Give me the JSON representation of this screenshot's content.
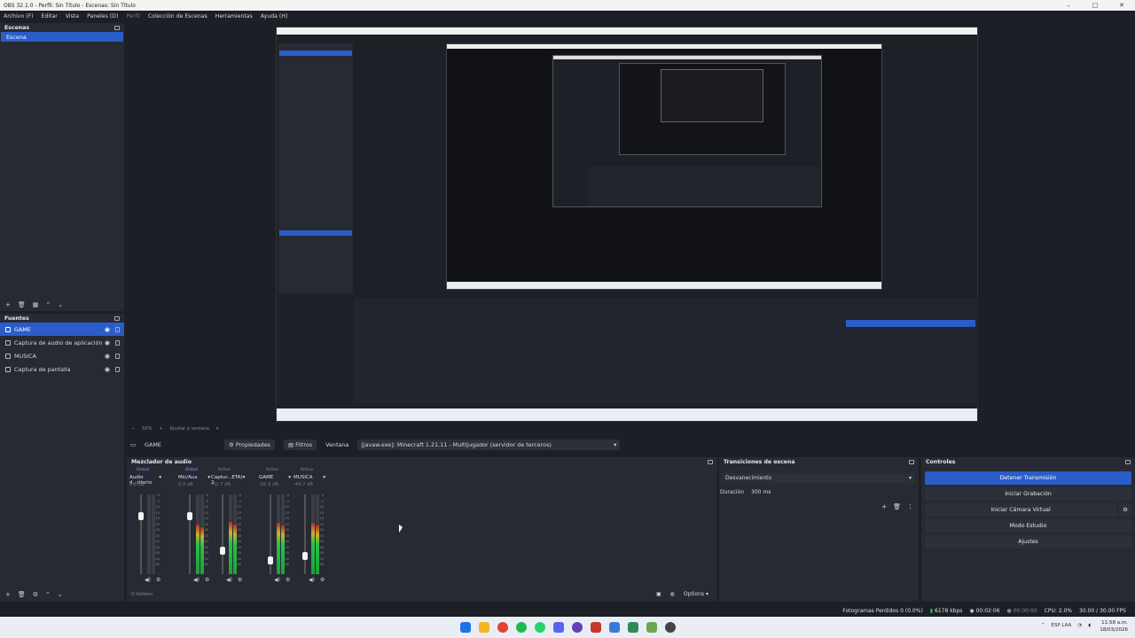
{
  "window": {
    "title": "OBS 32.1.0 - Perfil: Sin Título - Escenas: Sin Título",
    "minimize": "–",
    "maximize": "□",
    "close": "✕"
  },
  "menu": {
    "items": [
      "Archivo (F)",
      "Editar",
      "Vista",
      "Paneles (D)",
      "Perfil",
      "Colección de Escenas",
      "Herramientas",
      "Ayuda (H)"
    ]
  },
  "scenes": {
    "title": "Escenas",
    "items": [
      "Escena"
    ]
  },
  "sources": {
    "title": "Fuentes",
    "items": [
      "GAME",
      "Captura de audio de aplicación",
      "MUSICA",
      "Captura de pantalla"
    ]
  },
  "zoom": {
    "value": "50%",
    "fit_label": "Ajustar a ventana"
  },
  "context_bar": {
    "source": "GAME",
    "properties": "Propiedades",
    "filters": "Filtros",
    "window_label": "Ventana",
    "window_value": "[javaw.exe]: Minecraft 1.21.11 - Multijugador (servidor de terceros)"
  },
  "mixer": {
    "title": "Mezclador de audio",
    "hidden_label": "0 hidden",
    "channels": [
      {
        "tag": "Global",
        "name": "Audio d...ritorio",
        "db": "0.0 dB",
        "level": 0.0,
        "fader": 0.78
      },
      {
        "tag": "Global",
        "name": "Mic/Aux",
        "db": "0.0 dB",
        "level": 0.62,
        "fader": 0.78
      },
      {
        "tag": "Activo",
        "name": "Captur...ETA) 2",
        "db": "-32.7 dB",
        "level": 0.66,
        "fader": 0.35
      },
      {
        "tag": "Activo",
        "name": "GAME",
        "db": "-56.9 dB",
        "level": 0.64,
        "fader": 0.22
      },
      {
        "tag": "Activo",
        "name": "MUSICA",
        "db": "-44.7 dB",
        "level": 0.64,
        "fader": 0.28
      }
    ],
    "scale": [
      "0",
      "-5",
      "-10",
      "-15",
      "-20",
      "-25",
      "-30",
      "-35",
      "-40",
      "-45",
      "-50",
      "-55",
      "-60"
    ],
    "options_label": "Options"
  },
  "transitions": {
    "title": "Transiciones de escena",
    "transition": "Desvanecimiento",
    "duration_label": "Duración",
    "duration_value": "300 ms"
  },
  "controls": {
    "title": "Controles",
    "buttons": [
      "Detener Transmisión",
      "Iniciar Grabación",
      "Iniciar Cámara Virtual",
      "Modo Estudio",
      "Ajustes"
    ]
  },
  "status": {
    "dropped": "Fotogramas Perdidos 0 (0.0%)",
    "bitrate": "6178 kbps",
    "stream_time": "00:02:06",
    "rec_time": "00:00:00",
    "cpu": "CPU: 2.0%",
    "fps": "30.00 / 30.00 FPS"
  },
  "taskbar": {
    "lang": "ESP LAA",
    "time": "11:58 a.m.",
    "date": "18/03/2026"
  },
  "colors": {
    "accent": "#2a5dc8",
    "bg": "#1d1f26",
    "panel": "#272a33"
  }
}
